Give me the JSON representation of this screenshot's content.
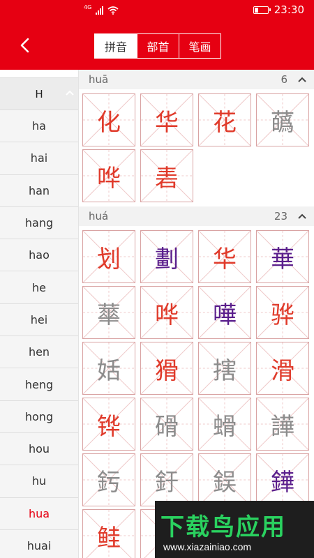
{
  "status_bar": {
    "signal": "4G",
    "time": "23:30"
  },
  "header": {
    "back_icon": "chevron-left-icon",
    "tabs": [
      {
        "label": "拼音",
        "active": true
      },
      {
        "label": "部首",
        "active": false
      },
      {
        "label": "笔画",
        "active": false
      }
    ]
  },
  "sidebar": {
    "letter": "H",
    "items": [
      "ha",
      "hai",
      "han",
      "hang",
      "hao",
      "he",
      "hei",
      "hen",
      "heng",
      "hong",
      "hou",
      "hu",
      "hua",
      "huai"
    ],
    "active": "hua"
  },
  "sections": [
    {
      "pinyin": "huā",
      "count": "6",
      "chars": [
        {
          "c": "化",
          "color": "red"
        },
        {
          "c": "华",
          "color": "red"
        },
        {
          "c": "花",
          "color": "red"
        },
        {
          "c": "蘤",
          "color": "gray"
        },
        {
          "c": "哗",
          "color": "red"
        },
        {
          "c": "砉",
          "color": "red"
        }
      ]
    },
    {
      "pinyin": "huá",
      "count": "23",
      "chars": [
        {
          "c": "划",
          "color": "red"
        },
        {
          "c": "劃",
          "color": "purple"
        },
        {
          "c": "华",
          "color": "red"
        },
        {
          "c": "華",
          "color": "purple"
        },
        {
          "c": "蕐",
          "color": "gray"
        },
        {
          "c": "哗",
          "color": "red"
        },
        {
          "c": "嘩",
          "color": "purple"
        },
        {
          "c": "骅",
          "color": "red"
        },
        {
          "c": "姡",
          "color": "gray"
        },
        {
          "c": "猾",
          "color": "red"
        },
        {
          "c": "搳",
          "color": "gray"
        },
        {
          "c": "滑",
          "color": "red"
        },
        {
          "c": "铧",
          "color": "red"
        },
        {
          "c": "磆",
          "color": "gray"
        },
        {
          "c": "螖",
          "color": "gray"
        },
        {
          "c": "譁",
          "color": "gray"
        },
        {
          "c": "釫",
          "color": "gray"
        },
        {
          "c": "釪",
          "color": "gray"
        },
        {
          "c": "鋘",
          "color": "gray"
        },
        {
          "c": "鏵",
          "color": "purple"
        },
        {
          "c": "鲑",
          "color": "red"
        },
        {
          "c": "",
          "color": "gray"
        }
      ]
    }
  ],
  "watermark": {
    "logo": "下载鸟应用",
    "url": "www.xiazainiao.com"
  },
  "colors": {
    "brand": "#e60012",
    "red_char": "#e03a2a",
    "purple_char": "#5a1e8c",
    "gray_char": "#8c8c8c"
  }
}
